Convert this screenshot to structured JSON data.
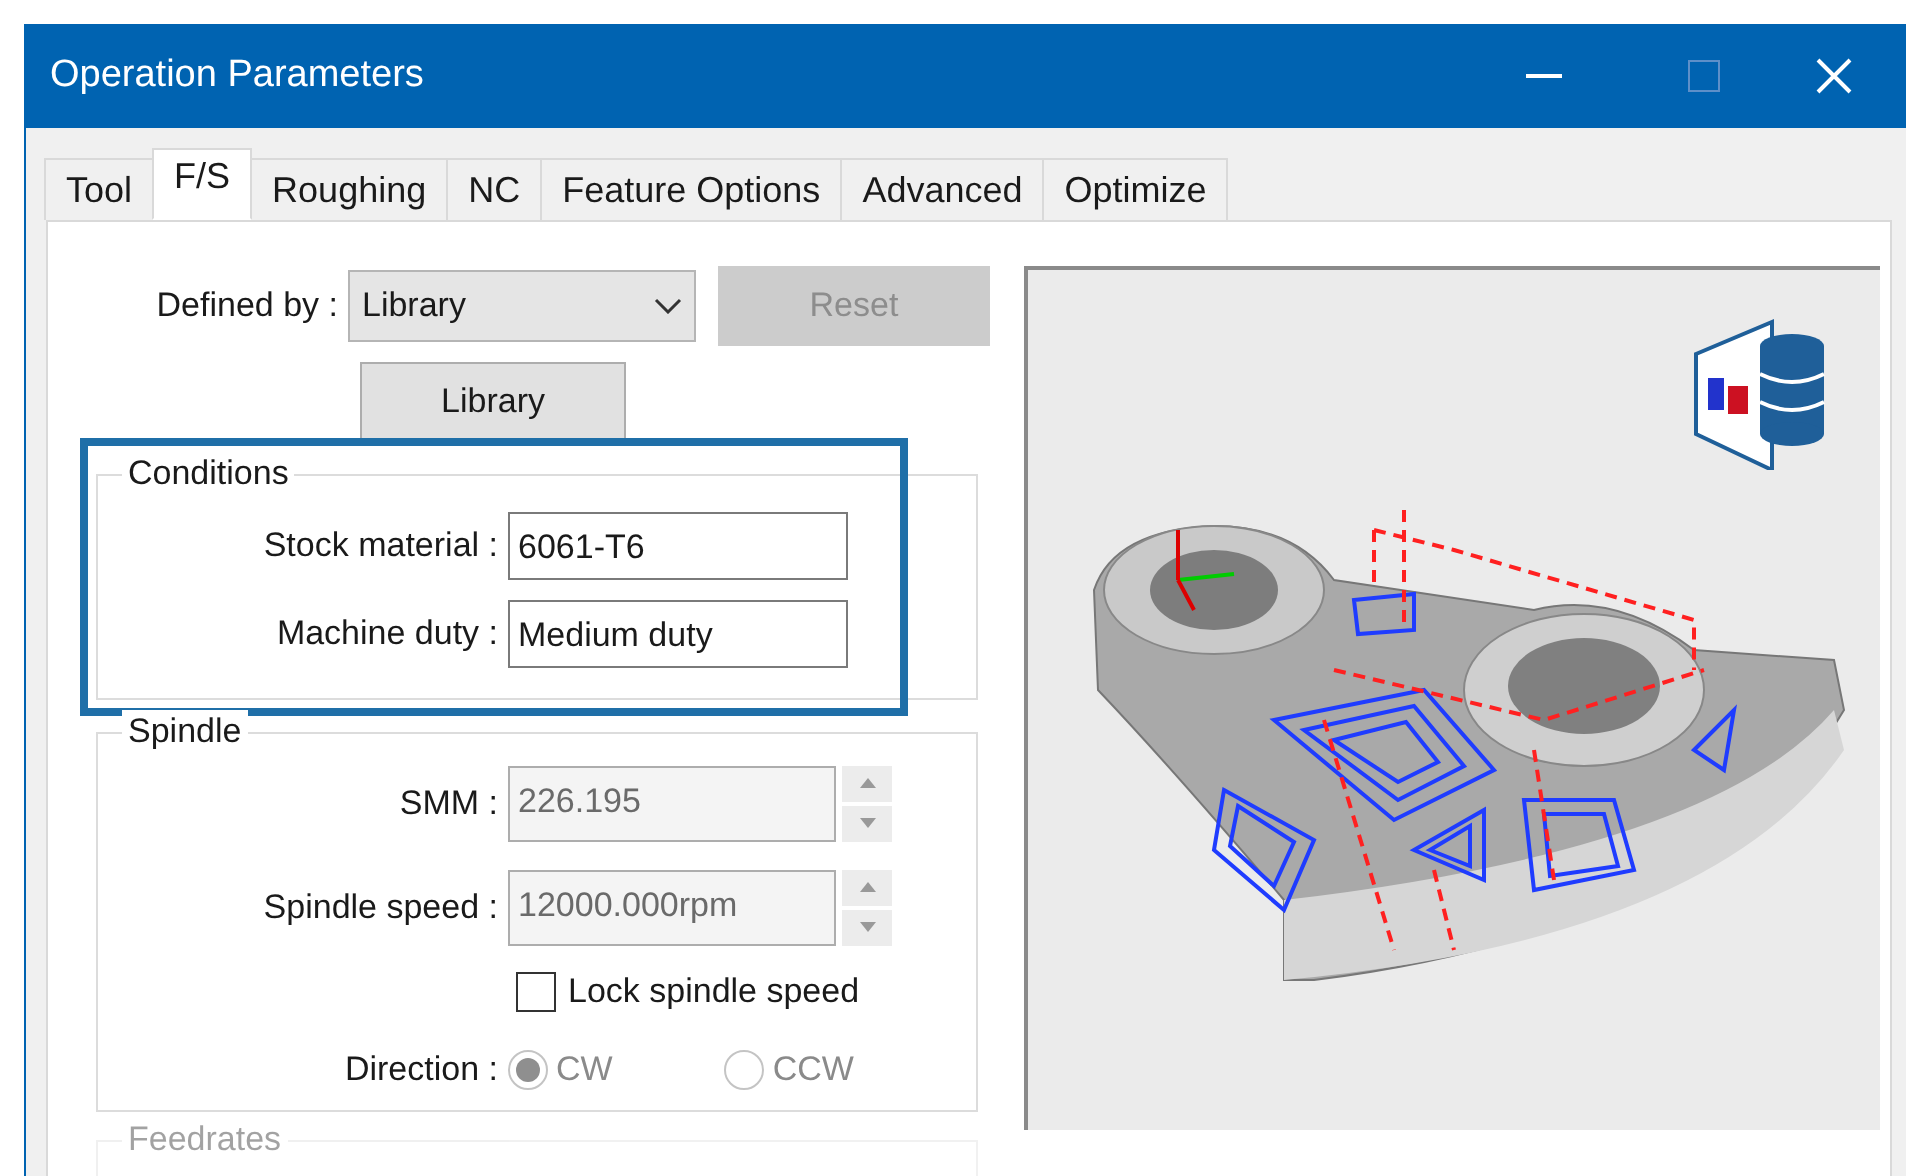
{
  "window": {
    "title": "Operation Parameters"
  },
  "tabs": [
    {
      "label": "Tool",
      "selected": false
    },
    {
      "label": "F/S",
      "selected": true
    },
    {
      "label": "Roughing",
      "selected": false
    },
    {
      "label": "NC",
      "selected": false
    },
    {
      "label": "Feature Options",
      "selected": false
    },
    {
      "label": "Advanced",
      "selected": false
    },
    {
      "label": "Optimize",
      "selected": false
    }
  ],
  "defined_by": {
    "label": "Defined by :",
    "value": "Library",
    "reset_button": {
      "label": "Reset",
      "disabled": true
    },
    "library_button": {
      "label": "Library"
    }
  },
  "conditions": {
    "title": "Conditions",
    "highlighted": true,
    "fields": [
      {
        "label": "Stock material :",
        "value": "6061-T6"
      },
      {
        "label": "Machine duty :",
        "value": "Medium duty"
      }
    ]
  },
  "spindle": {
    "title": "Spindle",
    "fields": [
      {
        "label": "SMM :",
        "value": "226.195",
        "disabled": true
      },
      {
        "label": "Spindle speed :",
        "value": "12000.000rpm",
        "disabled": true
      }
    ],
    "lock": {
      "label": "Lock spindle speed",
      "checked": false
    },
    "direction": {
      "label": "Direction :",
      "disabled": true,
      "options": [
        {
          "label": "CW",
          "selected": true
        },
        {
          "label": "CCW",
          "selected": false
        }
      ]
    }
  },
  "feedrates": {
    "title": "Feedrates"
  }
}
